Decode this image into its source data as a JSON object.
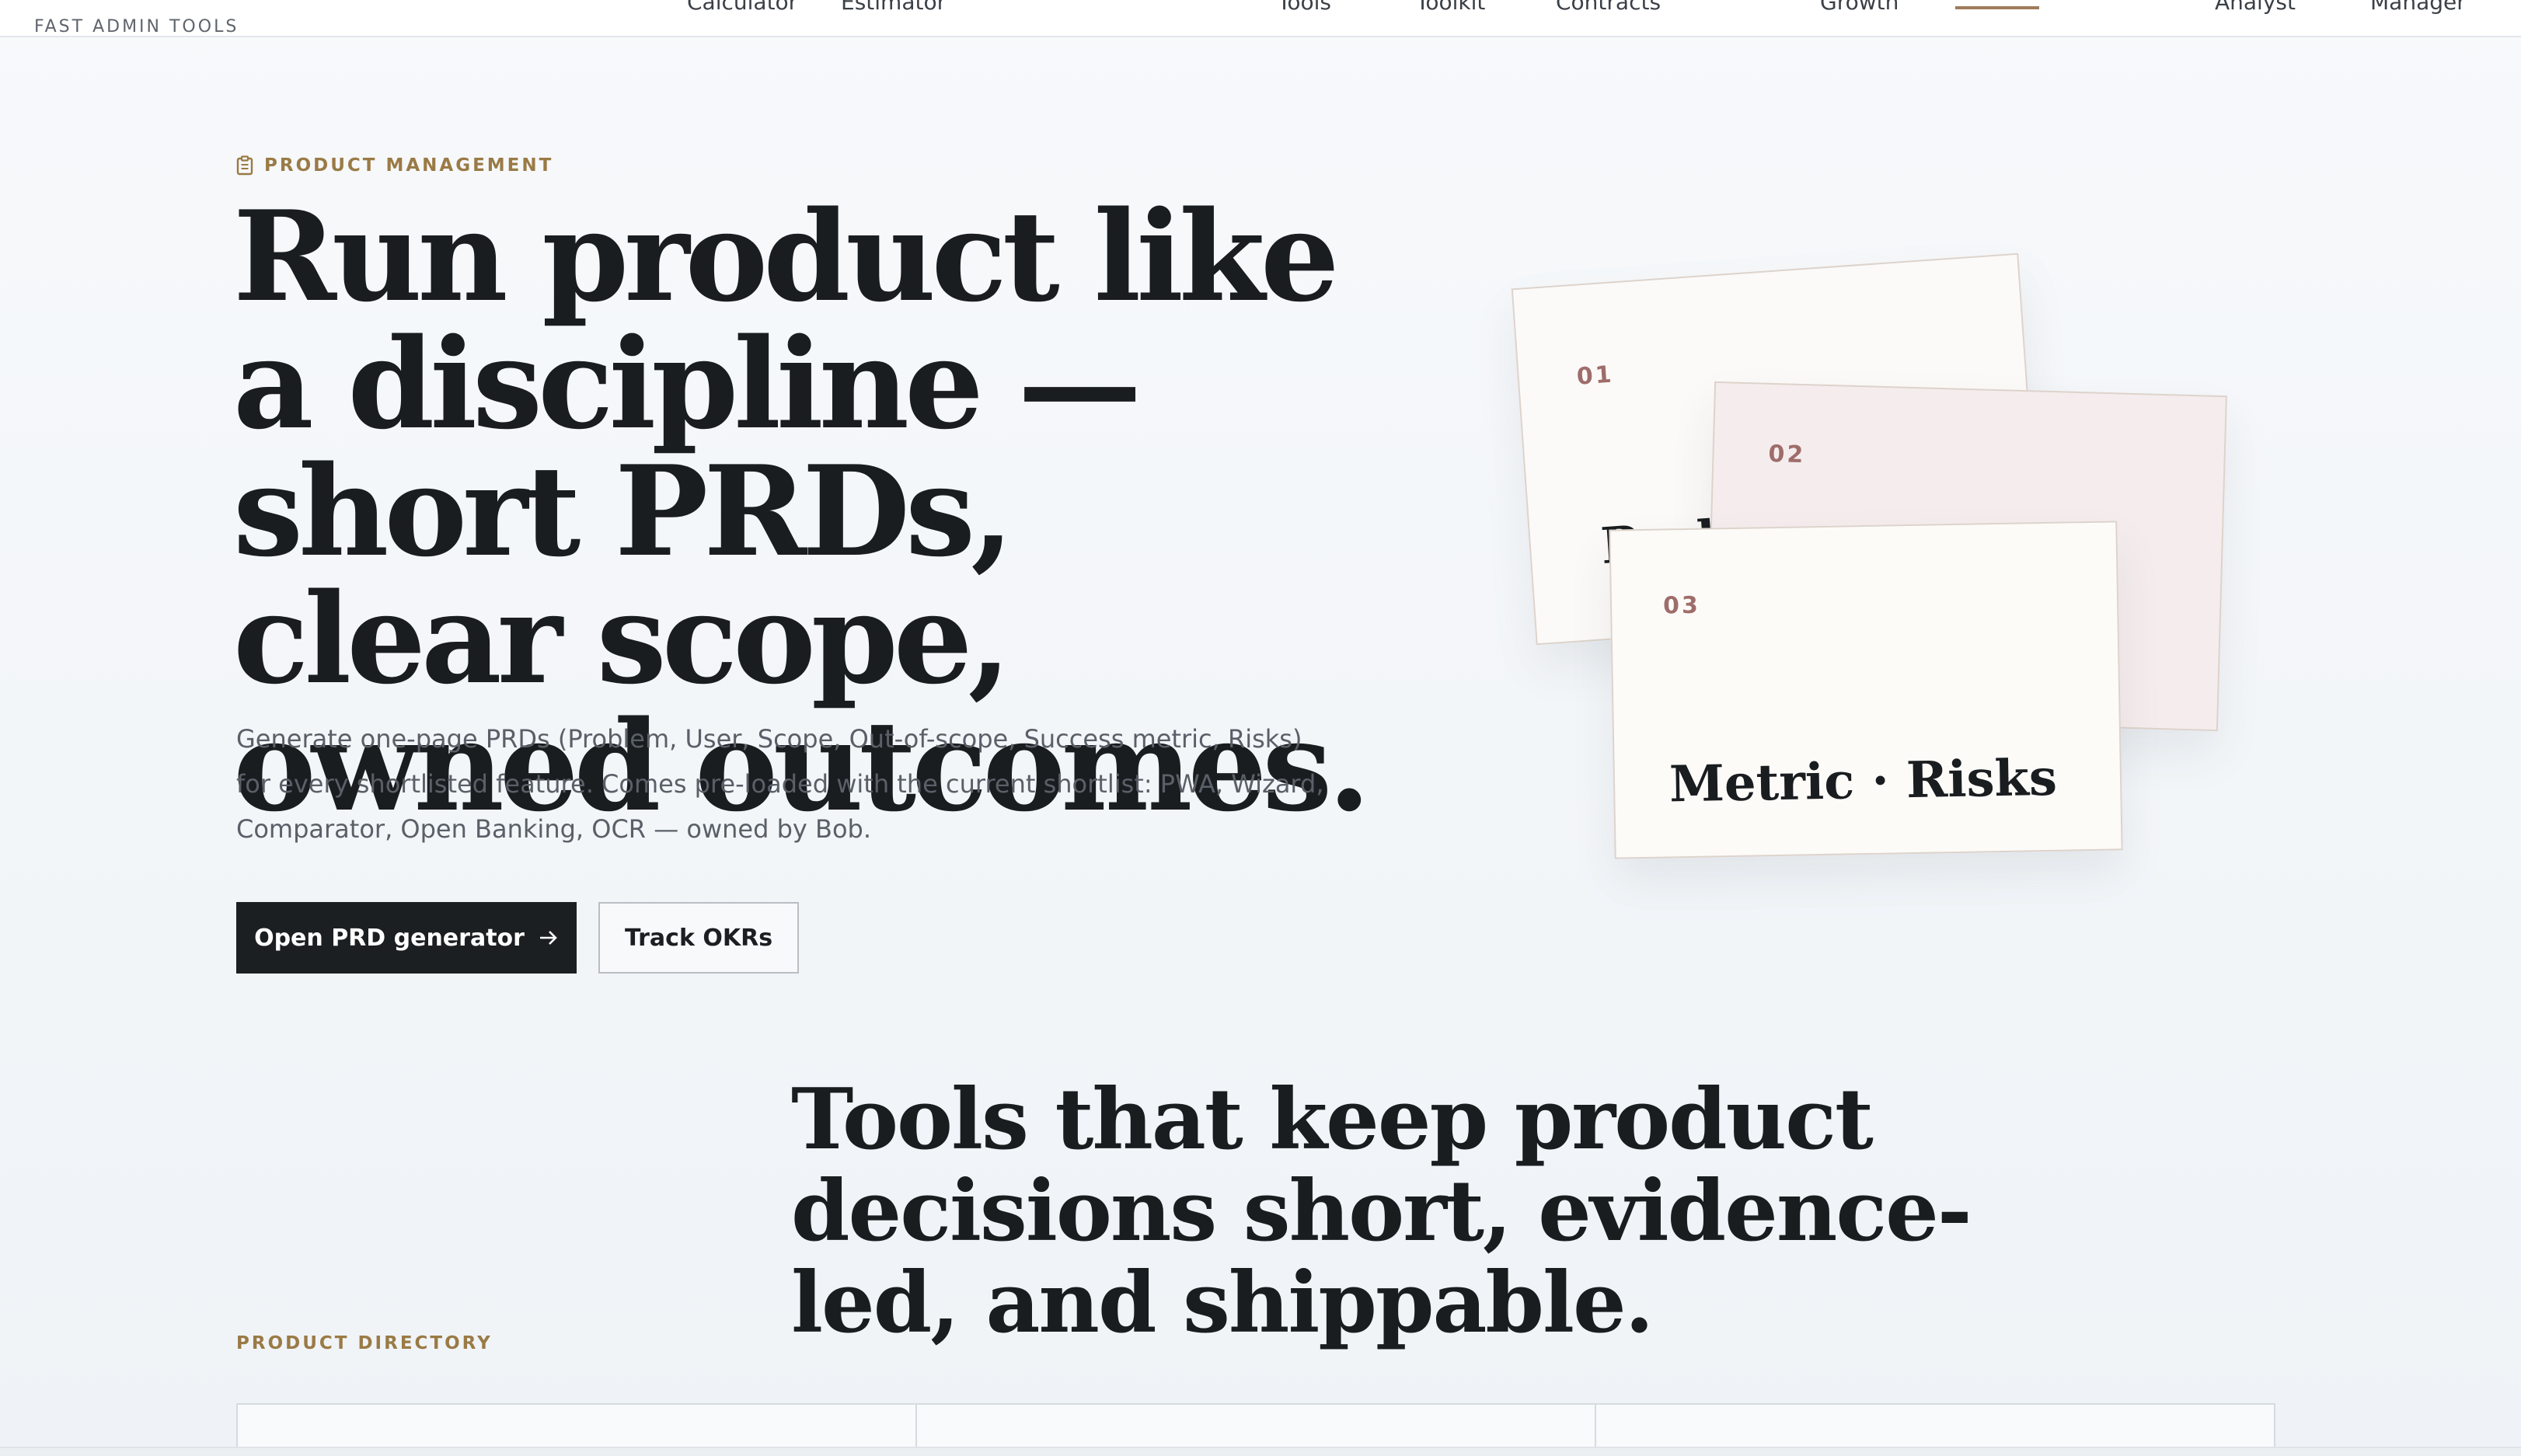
{
  "brand": "FAST ADMIN TOOLS",
  "nav": [
    "Calculator",
    "Estimator",
    "Tools",
    "Toolkit",
    "Contracts",
    "Growth",
    "Analyst",
    "Manager"
  ],
  "hero": {
    "eyebrow": "PRODUCT MANAGEMENT",
    "title": "Run product like a discipline — short PRDs, clear scope, owned outcomes.",
    "subtitle": "Generate one-page PRDs (Problem, User, Scope, Out-of-scope, Success metric, Risks) for every shortlisted feature. Comes pre-loaded with the current shortlist: PWA, Wizard, Comparator, Open Banking, OCR — owned by Bob.",
    "primary_cta": "Open PRD generator",
    "secondary_cta": "Track OKRs"
  },
  "cards": [
    {
      "num": "01",
      "title": "Problem"
    },
    {
      "num": "02",
      "title": ""
    },
    {
      "num": "03",
      "title": "Metric · Risks"
    }
  ],
  "section": {
    "title": "Tools that keep product decisions short, evidence-led, and shippable.",
    "eyebrow": "PRODUCT DIRECTORY"
  },
  "colors": {
    "accent": "#9a7a45",
    "card_number": "#9e6d6a",
    "primary_button": "#1c1f22"
  }
}
